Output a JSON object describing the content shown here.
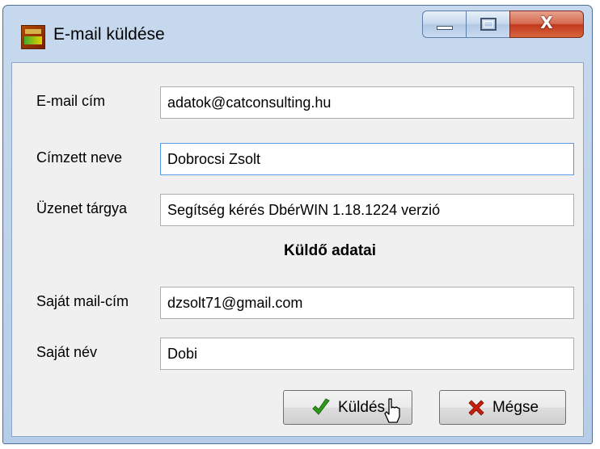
{
  "window": {
    "title": "E-mail küldése",
    "close_glyph": "X"
  },
  "form": {
    "fields": [
      {
        "label": "E-mail cím",
        "value": "adatok@catconsulting.hu"
      },
      {
        "label": "Címzett neve",
        "value": "Dobrocsi Zsolt"
      },
      {
        "label": "Üzenet tárgya",
        "value": "Segítség kérés DbérWIN 1.18.1224 verzió"
      },
      {
        "label": "Saját mail-cím",
        "value": "dzsolt71@gmail.com"
      },
      {
        "label": "Saját név",
        "value": "Dobi"
      }
    ],
    "section_title": "Küldő adatai"
  },
  "buttons": {
    "send_label": "Küldés",
    "cancel_label": "Mégse"
  },
  "icons": {
    "app": "app-icon",
    "send": "checkmark-icon",
    "cancel": "x-icon"
  },
  "colors": {
    "title_bar": "#c7d9ee",
    "close_button": "#c2391c",
    "check": "#2e9a1c",
    "cancel_x": "#c81e0a",
    "focus_border": "#569de5"
  }
}
